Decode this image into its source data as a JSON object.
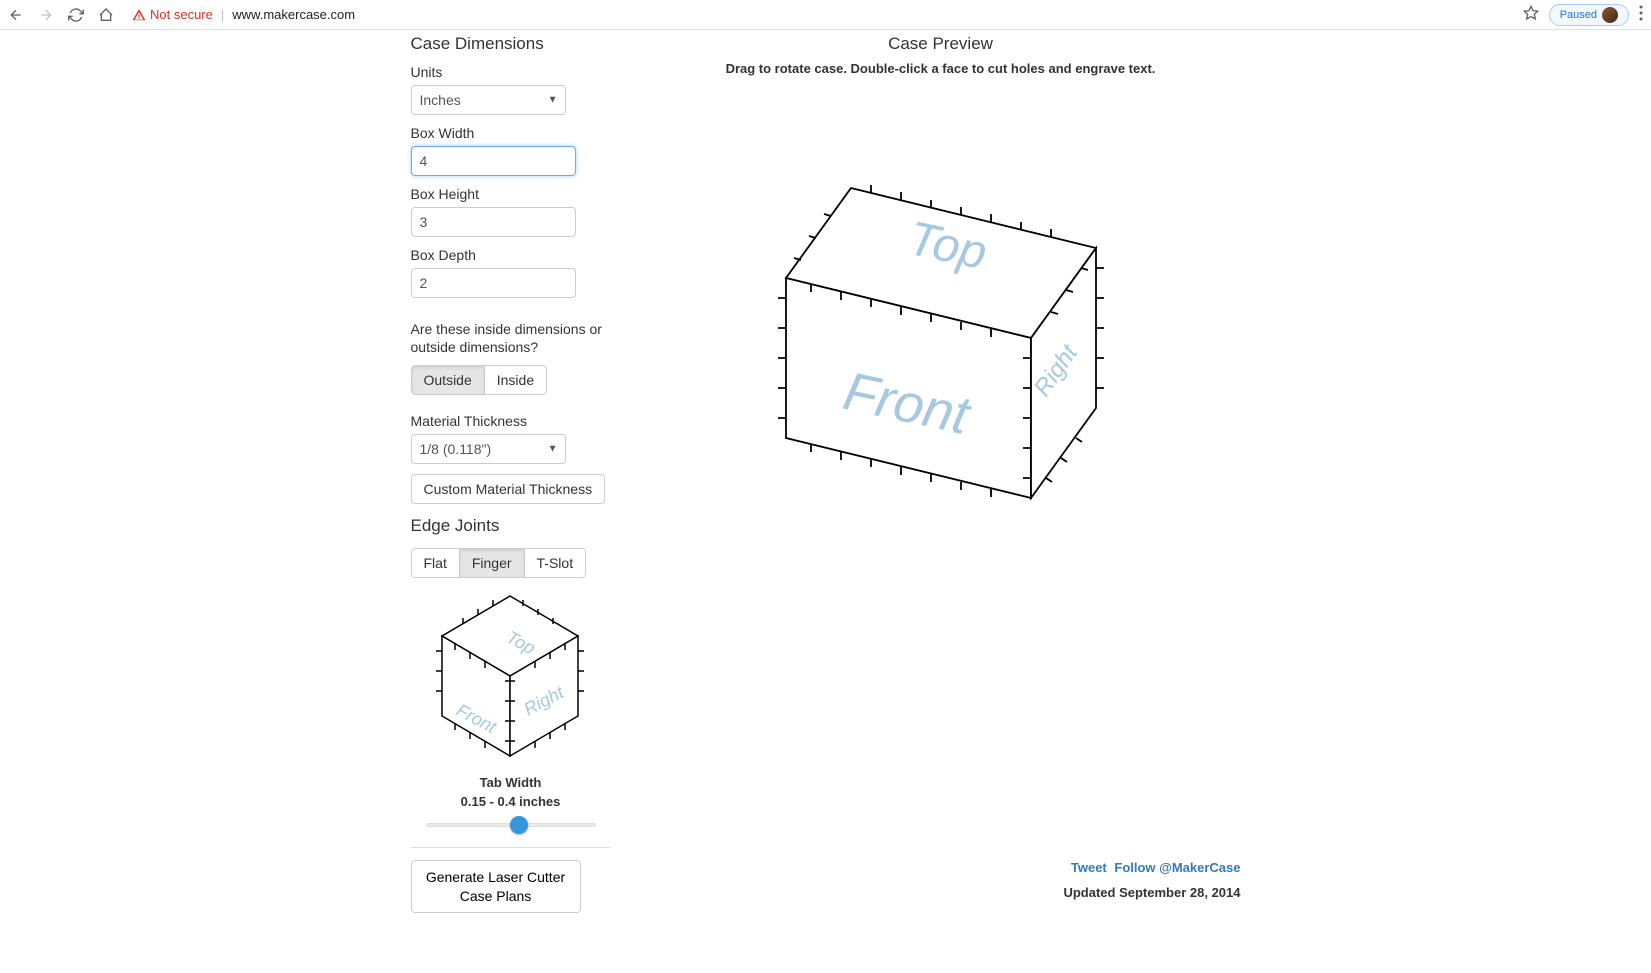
{
  "browser": {
    "not_secure_label": "Not secure",
    "url": "www.makercase.com",
    "paused_label": "Paused"
  },
  "dimensions": {
    "title": "Case Dimensions",
    "units_label": "Units",
    "units_value": "Inches",
    "width_label": "Box Width",
    "width_value": "4",
    "height_label": "Box Height",
    "height_value": "3",
    "depth_label": "Box Depth",
    "depth_value": "2",
    "inside_outside_label": "Are these inside dimensions or outside dimensions?",
    "outside_label": "Outside",
    "inside_label": "Inside",
    "thickness_label": "Material Thickness",
    "thickness_value": "1/8 (0.118\")",
    "custom_thickness_label": "Custom Material Thickness"
  },
  "joints": {
    "title": "Edge Joints",
    "flat_label": "Flat",
    "finger_label": "Finger",
    "tslot_label": "T-Slot",
    "tab_width_label": "Tab Width",
    "tab_width_range": "0.15 - 0.4 inches"
  },
  "preview": {
    "title": "Case Preview",
    "hint": "Drag to rotate case. Double-click a face to cut holes and engrave text.",
    "top_label": "Top",
    "front_label": "Front",
    "right_label": "Right"
  },
  "footer": {
    "generate_label": "Generate Laser Cutter Case Plans",
    "tweet_label": "Tweet",
    "follow_label": "Follow @MakerCase",
    "updated_label": "Updated September 28, 2014"
  }
}
